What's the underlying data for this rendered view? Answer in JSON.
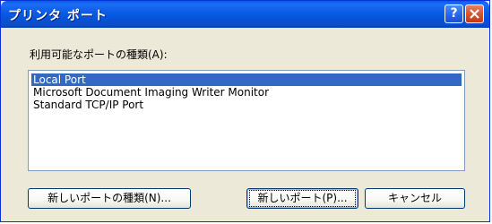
{
  "window": {
    "title": "プリンタ ポート"
  },
  "titlebar_buttons": {
    "help_icon": "question-mark-icon",
    "help_label": "?",
    "close_icon": "close-x-icon"
  },
  "port_list": {
    "label": "利用可能なポートの種類(A):",
    "items": [
      {
        "label": "Local Port",
        "selected": true
      },
      {
        "label": "Microsoft Document Imaging Writer Monitor",
        "selected": false
      },
      {
        "label": "Standard TCP/IP Port",
        "selected": false
      }
    ]
  },
  "buttons": {
    "new_port_type": "新しいポートの種類(N)...",
    "new_port": "新しいポート(P)...",
    "cancel": "キャンセル"
  },
  "colors": {
    "titlebar": "#0552d8",
    "dialog_bg": "#ece9d8",
    "selection": "#316ac5",
    "close_button": "#d4532c"
  }
}
